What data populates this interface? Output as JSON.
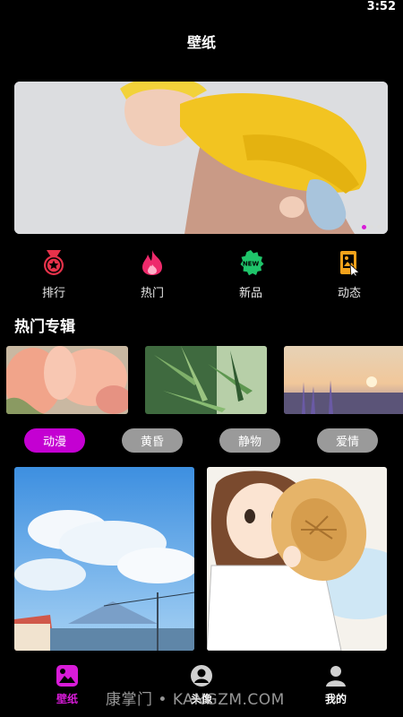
{
  "status_bar": {
    "time": "3:52"
  },
  "header": {
    "title": "壁纸"
  },
  "banner": {
    "image": "baby-in-yellow-sweater-photo",
    "page_count": 3,
    "active_index": 0
  },
  "quick_nav": [
    {
      "label": "排行",
      "icon": "medal-icon"
    },
    {
      "label": "热门",
      "icon": "flame-icon"
    },
    {
      "label": "新品",
      "icon": "new-badge-icon"
    },
    {
      "label": "动态",
      "icon": "live-wallpaper-icon"
    }
  ],
  "albums": {
    "title": "热门专辑",
    "items": [
      {
        "image": "pink-tulips-photo"
      },
      {
        "image": "green-bamboo-leaves-photo"
      },
      {
        "image": "lavender-sunset-photo"
      }
    ]
  },
  "filters": {
    "items": [
      "动漫",
      "黄昏",
      "静物",
      "爱情"
    ],
    "selected": "动漫"
  },
  "wallpapers": [
    {
      "image": "anime-sky-clouds-town"
    },
    {
      "image": "anime-girl-straw-hat"
    }
  ],
  "bottom_nav": [
    {
      "label": "壁纸",
      "icon": "image-icon",
      "active": true
    },
    {
      "label": "头像",
      "icon": "avatar-icon",
      "active": false
    },
    {
      "label": "我的",
      "icon": "profile-icon",
      "active": false
    }
  ],
  "watermark": "康掌门 • KANGZM.COM",
  "colors": {
    "accent": "#d81bd8",
    "chip": "#9a9a9a",
    "background": "#000000"
  }
}
